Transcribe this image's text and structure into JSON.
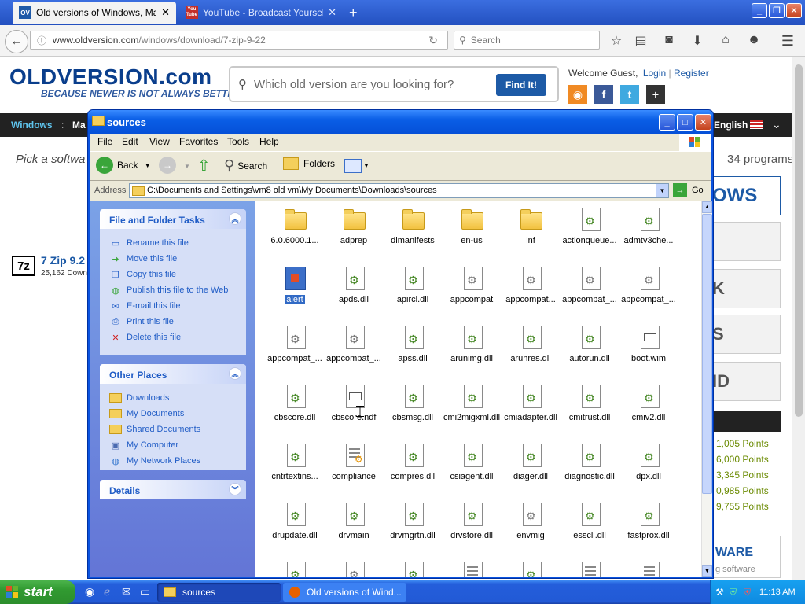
{
  "browser": {
    "tabs": [
      {
        "title": "Old versions of Windows, Ma...",
        "favicon": "OV"
      },
      {
        "title": "YouTube - Broadcast Yourself.",
        "favicon": "You Tube"
      }
    ],
    "new_tab_symbol": "+",
    "url": "www.oldversion.com/windows/download/7-zip-9-22",
    "url_host": "www.oldversion.com",
    "url_path": "/windows/download/7-zip-9-22",
    "search_placeholder": "Search"
  },
  "site": {
    "logo": "OLDVERSION.com",
    "tagline": "BECAUSE NEWER IS NOT ALWAYS BETTER!",
    "search_placeholder": "Which old version are you looking for?",
    "find_button": "Find It!",
    "welcome": "Welcome Guest,",
    "login": "Login",
    "register": "Register",
    "nav_windows": "Windows",
    "nav_sep": ":",
    "nav_partial": "Ma",
    "language": "English",
    "pick_text": "Pick a softwa",
    "programs_text": "34 programs",
    "item_title": "7 Zip 9.2",
    "item_icon": "7z",
    "item_downloads": "25,162 Down",
    "side_boxes": [
      "OWS",
      "",
      "K",
      "S",
      "ID"
    ],
    "points": [
      "1,005 Points",
      "6,000 Points",
      "3,345 Points",
      "0,985 Points",
      "9,755 Points"
    ],
    "ware": "WARE",
    "ware_sub": "g software"
  },
  "explorer": {
    "title": "sources",
    "menu": [
      "File",
      "Edit",
      "View",
      "Favorites",
      "Tools",
      "Help"
    ],
    "toolbar": {
      "back": "Back",
      "search": "Search",
      "folders": "Folders"
    },
    "address_label": "Address",
    "address_path": "C:\\Documents and Settings\\vm8 old vm\\My Documents\\Downloads\\sources",
    "go": "Go",
    "tasks_title": "File and Folder Tasks",
    "tasks": [
      "Rename this file",
      "Move this file",
      "Copy this file",
      "Publish this file to the Web",
      "E-mail this file",
      "Print this file",
      "Delete this file"
    ],
    "places_title": "Other Places",
    "places": [
      "Downloads",
      "My Documents",
      "Shared Documents",
      "My Computer",
      "My Network Places"
    ],
    "details_title": "Details",
    "files": [
      {
        "name": "6.0.6000.1...",
        "kind": "folder"
      },
      {
        "name": "adprep",
        "kind": "folder"
      },
      {
        "name": "dlmanifests",
        "kind": "folder"
      },
      {
        "name": "en-us",
        "kind": "folder"
      },
      {
        "name": "inf",
        "kind": "folder"
      },
      {
        "name": "actionqueue...",
        "kind": "dll"
      },
      {
        "name": "admtv3che...",
        "kind": "dll"
      },
      {
        "name": "alert",
        "kind": "app"
      },
      {
        "name": "apds.dll",
        "kind": "dll"
      },
      {
        "name": "apircl.dll",
        "kind": "dll"
      },
      {
        "name": "appcompat",
        "kind": "sys"
      },
      {
        "name": "appcompat...",
        "kind": "sys"
      },
      {
        "name": "appcompat_...",
        "kind": "sys"
      },
      {
        "name": "appcompat_...",
        "kind": "sys"
      },
      {
        "name": "appcompat_...",
        "kind": "sys"
      },
      {
        "name": "appcompat_...",
        "kind": "sys"
      },
      {
        "name": "apss.dll",
        "kind": "dll"
      },
      {
        "name": "arunimg.dll",
        "kind": "dll"
      },
      {
        "name": "arunres.dll",
        "kind": "dll"
      },
      {
        "name": "autorun.dll",
        "kind": "dll"
      },
      {
        "name": "boot.wim",
        "kind": "wim"
      },
      {
        "name": "cbscore.dll",
        "kind": "dll"
      },
      {
        "name": "cbscore.ndf",
        "kind": "wim"
      },
      {
        "name": "cbsmsg.dll",
        "kind": "dll"
      },
      {
        "name": "cmi2migxml.dll",
        "kind": "dll"
      },
      {
        "name": "cmiadapter.dll",
        "kind": "dll"
      },
      {
        "name": "cmitrust.dll",
        "kind": "dll"
      },
      {
        "name": "cmiv2.dll",
        "kind": "dll"
      },
      {
        "name": "cntrtextins...",
        "kind": "dll"
      },
      {
        "name": "compliance",
        "kind": "ini"
      },
      {
        "name": "compres.dll",
        "kind": "dll"
      },
      {
        "name": "csiagent.dll",
        "kind": "dll"
      },
      {
        "name": "diager.dll",
        "kind": "dll"
      },
      {
        "name": "diagnostic.dll",
        "kind": "dll"
      },
      {
        "name": "dpx.dll",
        "kind": "dll"
      },
      {
        "name": "drupdate.dll",
        "kind": "dll"
      },
      {
        "name": "drvmain",
        "kind": "dll"
      },
      {
        "name": "drvmgrtn.dll",
        "kind": "dll"
      },
      {
        "name": "drvstore.dll",
        "kind": "dll"
      },
      {
        "name": "envmig",
        "kind": "sys"
      },
      {
        "name": "esscli.dll",
        "kind": "dll"
      },
      {
        "name": "fastprox.dll",
        "kind": "dll"
      }
    ],
    "selected_index": 7
  },
  "taskbar": {
    "start": "start",
    "buttons": [
      "sources",
      "Old versions of Wind..."
    ],
    "clock": "11:13 AM"
  },
  "colors": {
    "xp_blue": "#0a53e0",
    "start_green": "#3aa53a",
    "link_blue": "#215dc6",
    "site_blue": "#0a3e8c"
  }
}
